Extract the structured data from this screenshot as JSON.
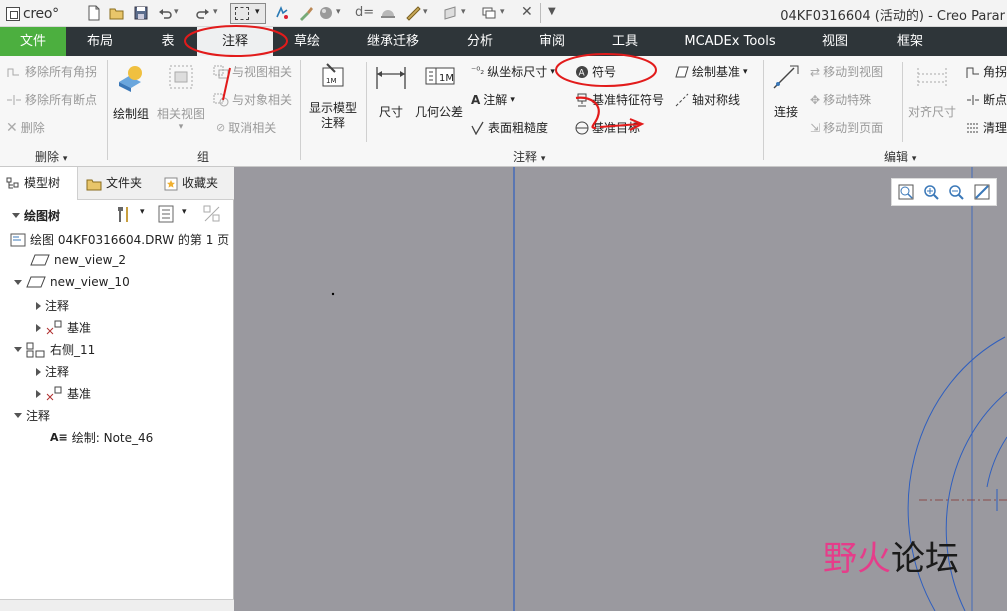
{
  "app": {
    "logo_text": "creo°",
    "window_title": "04KF0316604 (活动的) - Creo Parar"
  },
  "tabs": [
    "文件",
    "布局",
    "表",
    "注释",
    "草绘",
    "继承迁移",
    "分析",
    "审阅",
    "工具",
    "MCADEx Tools",
    "视图",
    "框架"
  ],
  "active_tab": "注释",
  "ribbon": {
    "delete_group": {
      "items": [
        "移除所有角拐",
        "移除所有断点",
        "删除"
      ],
      "label": "删除"
    },
    "group_group": {
      "draw_group": "绘制组",
      "related_view": "相关视图",
      "view_related": "与视图相关",
      "object_related": "与对象相关",
      "cancel_related": "取消相关",
      "label": "组"
    },
    "annotation_group": {
      "show_model_annotation": "显示模型\n注释",
      "dimension": "尺寸",
      "geometric_tolerance": "几何公差",
      "ordinate_dimension": "纵坐标尺寸",
      "note": "注解",
      "surface_finish": "表面粗糙度",
      "symbol": "符号",
      "datum_feature_symbol": "基准特征符号",
      "datum_target": "基准目标",
      "draw_datum": "绘制基准",
      "axis_symmetry": "轴对称线",
      "label": "注释"
    },
    "edit_group": {
      "connect": "连接",
      "move_to_view": "移动到视图",
      "move_special": "移动特殊",
      "move_to_page": "移动到页面",
      "align_dimension": "对齐尺寸",
      "corner": "角拐",
      "break": "断点",
      "clean": "清理",
      "label": "编辑"
    }
  },
  "panel_tabs": [
    "模型树",
    "文件夹",
    "收藏夹"
  ],
  "tree": {
    "header": "绘图树",
    "items": [
      "绘图 04KF0316604.DRW 的第 1 页",
      "new_view_2",
      "new_view_10",
      "注释",
      "基准",
      "右侧_11",
      "注释",
      "基准",
      "注释",
      "绘制: Note_46"
    ]
  },
  "watermark": {
    "text_colored": "野火",
    "text_dark": "论坛"
  }
}
